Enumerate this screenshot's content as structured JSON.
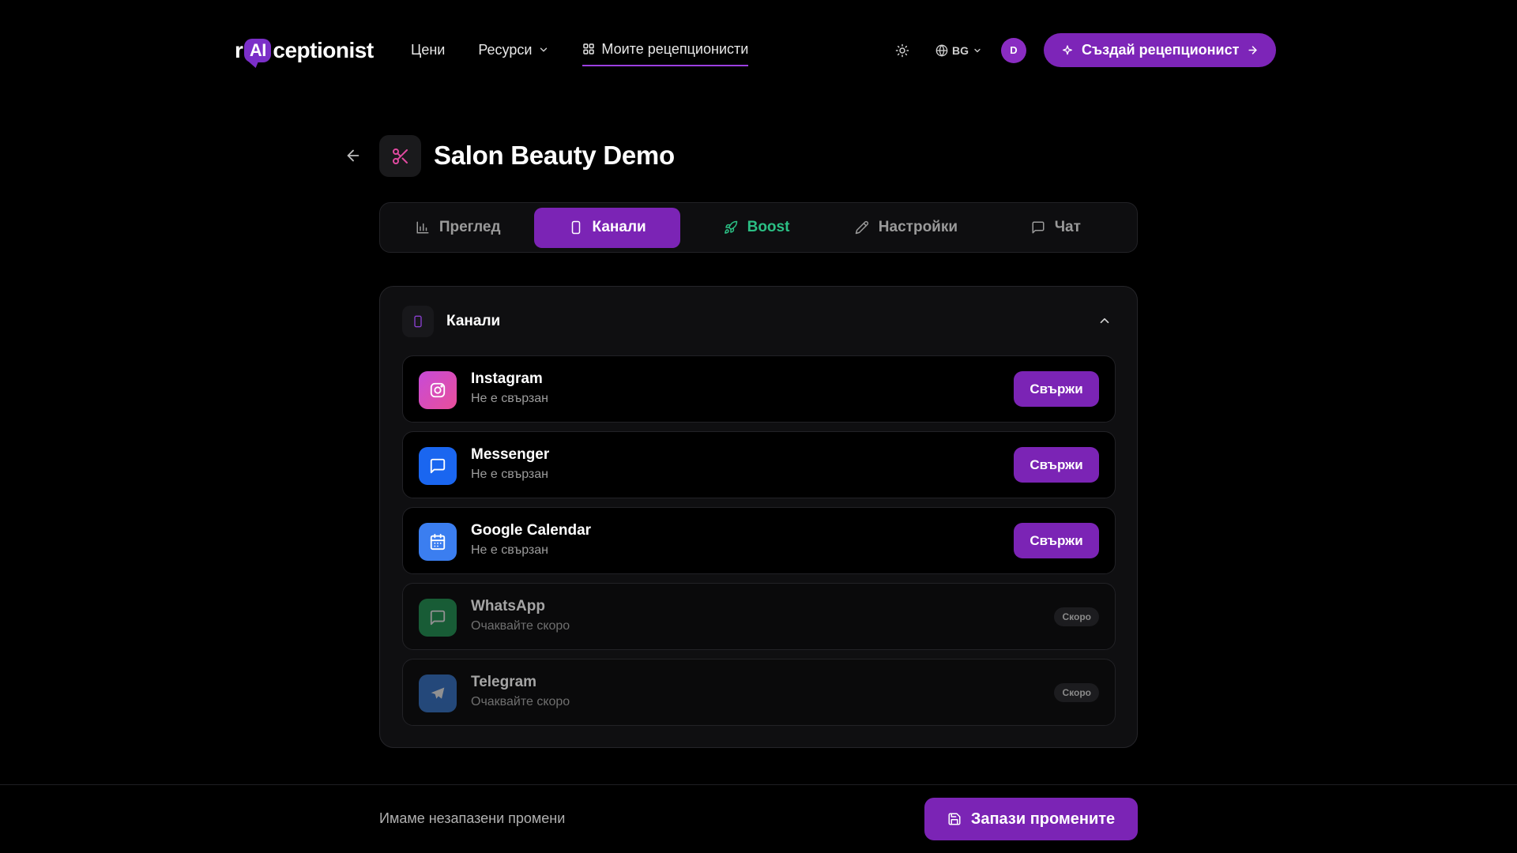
{
  "brand": {
    "prefix": "r",
    "highlight": "AI",
    "suffix": "ceptionist"
  },
  "nav": {
    "prices": "Цени",
    "resources": "Ресурси",
    "my_receptionists": "Моите рецепционисти",
    "language": "BG",
    "avatar_initial": "D",
    "create_button": "Създай рецепционист"
  },
  "page": {
    "title": "Salon Beauty Demo"
  },
  "tabs": [
    {
      "label": "Преглед",
      "icon": "bar-chart-icon"
    },
    {
      "label": "Канали",
      "icon": "smartphone-icon",
      "active": true
    },
    {
      "label": "Boost",
      "icon": "rocket-icon"
    },
    {
      "label": "Настройки",
      "icon": "pencil-icon"
    },
    {
      "label": "Чат",
      "icon": "chat-icon"
    }
  ],
  "channels_panel": {
    "title": "Канали",
    "items": [
      {
        "name": "Instagram",
        "status": "Не е свързан",
        "action": "Свържи",
        "icon": "instagram-icon",
        "color": "#d04fc0"
      },
      {
        "name": "Messenger",
        "status": "Не е свързан",
        "action": "Свържи",
        "icon": "messenger-icon",
        "color": "#1a66f0"
      },
      {
        "name": "Google Calendar",
        "status": "Не е свързан",
        "action": "Свържи",
        "icon": "calendar-icon",
        "color": "#3b7ef0"
      },
      {
        "name": "WhatsApp",
        "status": "Очаквайте скоро",
        "badge": "Скоро",
        "icon": "whatsapp-icon",
        "color": "#25a05a"
      },
      {
        "name": "Telegram",
        "status": "Очаквайте скоро",
        "badge": "Скоро",
        "icon": "telegram-icon",
        "color": "#3a7bd5"
      }
    ]
  },
  "footer": {
    "unsaved_text": "Имаме незапазени промени",
    "save_button": "Запази промените"
  },
  "colors": {
    "accent": "#7b24b5",
    "boost": "#2bbf84",
    "background": "#000000"
  }
}
